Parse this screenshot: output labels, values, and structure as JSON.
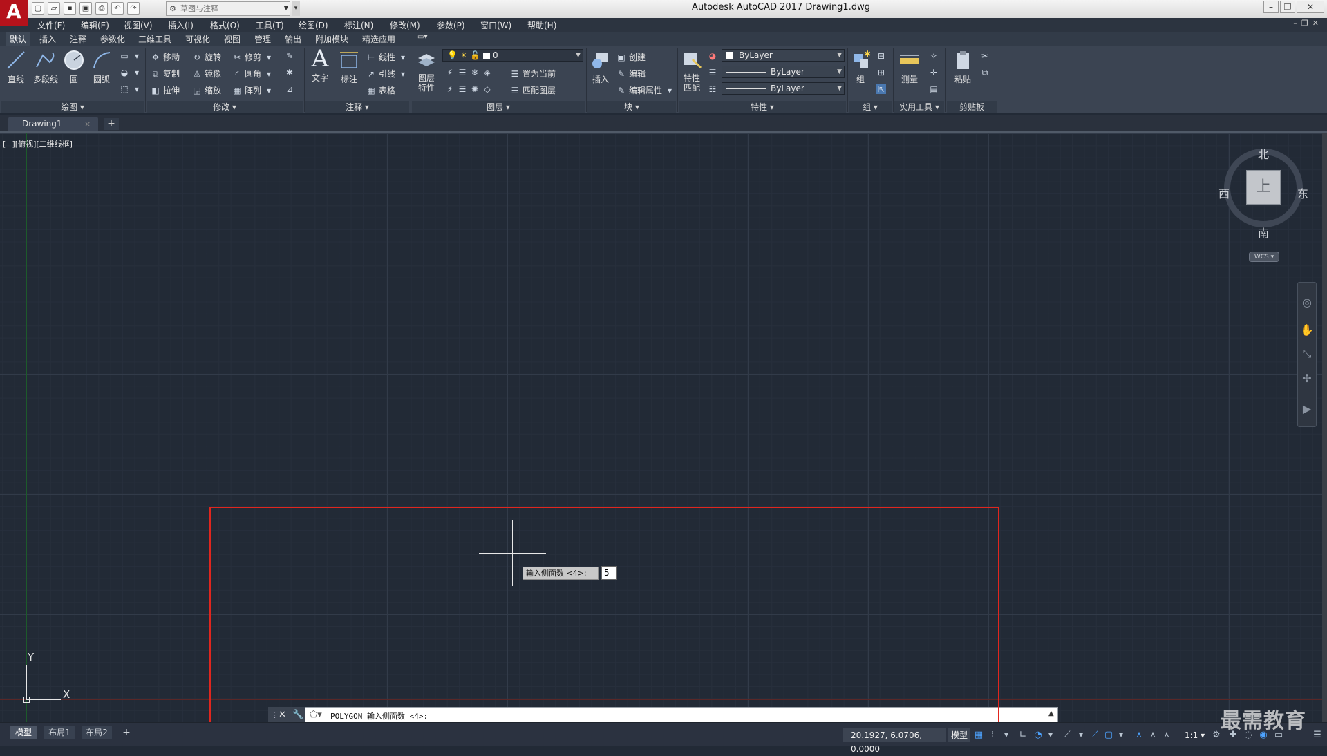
{
  "app": {
    "logo": "A",
    "title": "Autodesk AutoCAD 2017    Drawing1.dwg",
    "workspace": "草图与注释"
  },
  "quick_access": [
    "new-icon",
    "open-icon",
    "save-icon",
    "saveas-icon",
    "print-icon",
    "undo-icon",
    "redo-icon"
  ],
  "menu": [
    "文件(F)",
    "编辑(E)",
    "视图(V)",
    "插入(I)",
    "格式(O)",
    "工具(T)",
    "绘图(D)",
    "标注(N)",
    "修改(M)",
    "参数(P)",
    "窗口(W)",
    "帮助(H)"
  ],
  "ribbon_tabs": [
    "默认",
    "插入",
    "注释",
    "参数化",
    "三维工具",
    "可视化",
    "视图",
    "管理",
    "输出",
    "附加模块",
    "精选应用"
  ],
  "ribbon": {
    "draw": {
      "title": "绘图",
      "line": "直线",
      "polyline": "多段线",
      "circle": "圆",
      "arc": "圆弧"
    },
    "modify": {
      "title": "修改",
      "move": "移动",
      "rotate": "旋转",
      "trim": "修剪",
      "copy": "复制",
      "mirror": "镜像",
      "fillet": "圆角",
      "stretch": "拉伸",
      "scale": "缩放",
      "array": "阵列"
    },
    "annotation": {
      "title": "注释",
      "text": "文字",
      "dimension": "标注",
      "linear": "线性",
      "leader": "引线",
      "table": "表格"
    },
    "layers": {
      "title": "图层",
      "props": "图层\n特性",
      "current_layer": "0",
      "make_current": "置为当前",
      "match": "匹配图层"
    },
    "block": {
      "title": "块",
      "insert": "插入",
      "create": "创建",
      "edit": "编辑",
      "edit_attr": "编辑属性"
    },
    "properties": {
      "title": "特性",
      "match": "特性\n匹配",
      "color": "ByLayer",
      "linetype": "ByLayer",
      "lineweight": "ByLayer"
    },
    "groups": {
      "title": "组",
      "group": "组"
    },
    "utilities": {
      "title": "实用工具",
      "measure": "测量"
    },
    "clipboard": {
      "title": "剪贴板",
      "paste": "粘贴"
    }
  },
  "doc_tab": {
    "name": "Drawing1",
    "close": "×",
    "add": "+"
  },
  "viewport": {
    "label": "[−][俯视][二维线框]"
  },
  "ucs": {
    "y": "Y",
    "x": "X"
  },
  "viewcube": {
    "north": "北",
    "south": "南",
    "east": "东",
    "west": "西",
    "face": "上",
    "wcs": "WCS ▾"
  },
  "dynamic_input": {
    "prompt": "输入侧面数 <4>:",
    "value": "5"
  },
  "command_line": {
    "text": "POLYGON 输入侧面数 <4>:"
  },
  "layout_tabs": [
    "模型",
    "布局1",
    "布局2"
  ],
  "status": {
    "coords": "20.1927, 6.0706, 0.0000",
    "model": "模型",
    "scale": "1:1 ▾"
  },
  "watermark": "最需教育",
  "colors": {
    "highlight": "#e0261e",
    "canvas": "#222a36",
    "logo": "#b5121b"
  }
}
